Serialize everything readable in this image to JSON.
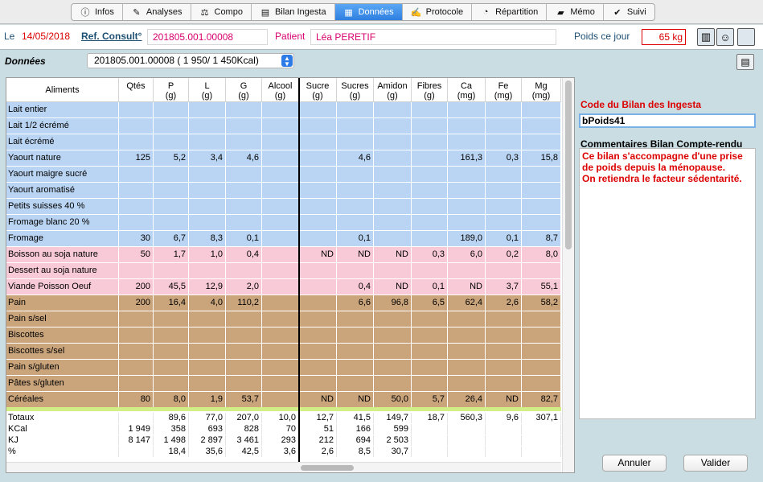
{
  "tabs": [
    {
      "label": "Infos",
      "icon": "info-icon",
      "glyph": "ⓘ"
    },
    {
      "label": "Analyses",
      "icon": "pen-icon",
      "glyph": "✎"
    },
    {
      "label": "Compo",
      "icon": "scale-icon",
      "glyph": "⚖"
    },
    {
      "label": "Bilan Ingesta",
      "icon": "glass-icon",
      "glyph": "▤"
    },
    {
      "label": "Données",
      "icon": "table-icon",
      "glyph": "▦"
    },
    {
      "label": "Protocole",
      "icon": "document-icon",
      "glyph": "✍"
    },
    {
      "label": "Répartition",
      "icon": "clock-icon",
      "glyph": "◔"
    },
    {
      "label": "Mémo",
      "icon": "folder-icon",
      "glyph": "▰"
    },
    {
      "label": "Suivi",
      "icon": "checklist-icon",
      "glyph": "✔"
    }
  ],
  "header": {
    "le_label": "Le",
    "date": "14/05/2018",
    "ref_label": "Ref. Consult°",
    "ref_value": "201805.001.00008",
    "patient_label": "Patient",
    "patient_value": "Léa PERETIF",
    "poids_label": "Poids ce jour",
    "poids_value": "65 kg",
    "buttons": [
      {
        "name": "notepad-icon",
        "glyph": "▥"
      },
      {
        "name": "people-icon",
        "glyph": "☺"
      },
      {
        "name": "square-icon",
        "glyph": ""
      }
    ]
  },
  "donnees_label": "Données",
  "select_value": "201805.001.00008 (  1 950/  1 450Kcal)",
  "table": {
    "headers": [
      "Aliments",
      "Qtés",
      "P\n(g)",
      "L\n(g)",
      "G\n(g)",
      "Alcool\n(g)",
      "Sucre\n(g)",
      "Sucres\n(g)",
      "Amidon\n(g)",
      "Fibres\n(g)",
      "Ca\n(mg)",
      "Fe\n(mg)",
      "Mg\n(mg)"
    ],
    "rows": [
      {
        "color": "blue",
        "cells": [
          "Lait entier",
          "",
          "",
          "",
          "",
          "",
          "",
          "",
          "",
          "",
          "",
          "",
          ""
        ]
      },
      {
        "color": "blue",
        "cells": [
          "Lait 1/2 écrémé",
          "",
          "",
          "",
          "",
          "",
          "",
          "",
          "",
          "",
          "",
          "",
          ""
        ]
      },
      {
        "color": "blue",
        "cells": [
          "Lait écrémé",
          "",
          "",
          "",
          "",
          "",
          "",
          "",
          "",
          "",
          "",
          "",
          ""
        ]
      },
      {
        "color": "blue",
        "cells": [
          "Yaourt nature",
          "125",
          "5,2",
          "3,4",
          "4,6",
          "",
          "",
          "4,6",
          "",
          "",
          "161,3",
          "0,3",
          "15,8"
        ]
      },
      {
        "color": "blue",
        "cells": [
          "Yaourt maigre sucré",
          "",
          "",
          "",
          "",
          "",
          "",
          "",
          "",
          "",
          "",
          "",
          ""
        ]
      },
      {
        "color": "blue",
        "cells": [
          "Yaourt aromatisé",
          "",
          "",
          "",
          "",
          "",
          "",
          "",
          "",
          "",
          "",
          "",
          ""
        ]
      },
      {
        "color": "blue",
        "cells": [
          "Petits suisses 40 %",
          "",
          "",
          "",
          "",
          "",
          "",
          "",
          "",
          "",
          "",
          "",
          ""
        ]
      },
      {
        "color": "blue",
        "cells": [
          "Fromage blanc 20 %",
          "",
          "",
          "",
          "",
          "",
          "",
          "",
          "",
          "",
          "",
          "",
          ""
        ]
      },
      {
        "color": "blue",
        "cells": [
          "Fromage",
          "30",
          "6,7",
          "8,3",
          "0,1",
          "",
          "",
          "0,1",
          "",
          "",
          "189,0",
          "0,1",
          "8,7"
        ]
      },
      {
        "color": "pink",
        "cells": [
          "Boisson au soja nature",
          "50",
          "1,7",
          "1,0",
          "0,4",
          "",
          "ND",
          "ND",
          "ND",
          "0,3",
          "6,0",
          "0,2",
          "8,0"
        ]
      },
      {
        "color": "pink",
        "cells": [
          "Dessert au soja nature",
          "",
          "",
          "",
          "",
          "",
          "",
          "",
          "",
          "",
          "",
          "",
          ""
        ]
      },
      {
        "color": "pink",
        "cells": [
          "Viande Poisson Oeuf",
          "200",
          "45,5",
          "12,9",
          "2,0",
          "",
          "",
          "0,4",
          "ND",
          "0,1",
          "ND",
          "3,7",
          "55,1"
        ]
      },
      {
        "color": "tan",
        "cells": [
          "Pain",
          "200",
          "16,4",
          "4,0",
          "110,2",
          "",
          "",
          "6,6",
          "96,8",
          "6,5",
          "62,4",
          "2,6",
          "58,2"
        ]
      },
      {
        "color": "tan",
        "cells": [
          "Pain s/sel",
          "",
          "",
          "",
          "",
          "",
          "",
          "",
          "",
          "",
          "",
          "",
          ""
        ]
      },
      {
        "color": "tan",
        "cells": [
          "Biscottes",
          "",
          "",
          "",
          "",
          "",
          "",
          "",
          "",
          "",
          "",
          "",
          ""
        ]
      },
      {
        "color": "tan",
        "cells": [
          "Biscottes s/sel",
          "",
          "",
          "",
          "",
          "",
          "",
          "",
          "",
          "",
          "",
          "",
          ""
        ]
      },
      {
        "color": "tan",
        "cells": [
          "Pain s/gluten",
          "",
          "",
          "",
          "",
          "",
          "",
          "",
          "",
          "",
          "",
          "",
          ""
        ]
      },
      {
        "color": "tan",
        "cells": [
          "Pâtes s/gluten",
          "",
          "",
          "",
          "",
          "",
          "",
          "",
          "",
          "",
          "",
          "",
          ""
        ]
      },
      {
        "color": "tan",
        "cells": [
          "Céréales",
          "80",
          "8,0",
          "1,9",
          "53,7",
          "",
          "ND",
          "ND",
          "50,0",
          "5,7",
          "26,4",
          "ND",
          "82,7"
        ]
      }
    ],
    "totals": [
      [
        "Totaux",
        "",
        "89,6",
        "77,0",
        "207,0",
        "10,0",
        "12,7",
        "41,5",
        "149,7",
        "18,7",
        "560,3",
        "9,6",
        "307,1"
      ],
      [
        "KCal",
        "1 949",
        "358",
        "693",
        "828",
        "70",
        "51",
        "166",
        "599",
        "",
        "",
        "",
        ""
      ],
      [
        "KJ",
        "8 147",
        "1 498",
        "2 897",
        "3 461",
        "293",
        "212",
        "694",
        "2 503",
        "",
        "",
        "",
        ""
      ],
      [
        "%",
        "",
        "18,4",
        "35,6",
        "42,5",
        "3,6",
        "2,6",
        "8,5",
        "30,7",
        "",
        "",
        "",
        ""
      ]
    ]
  },
  "code_label": "Code du Bilan des Ingesta",
  "code_value": "bPoids41",
  "comments_label": "Commentaires Bilan Compte-rendu",
  "comments_text": "Ce bilan s'accompagne d'une prise de poids depuis la ménopause.\nOn retiendra le facteur sédentarité.",
  "buttons": {
    "cancel": "Annuler",
    "validate": "Valider"
  },
  "colors": {
    "blue": "#bad5f3",
    "pink": "#f8cad8",
    "tan": "#caa57c",
    "accent": "#dc0000",
    "tab_active": "#2f7fe0"
  }
}
